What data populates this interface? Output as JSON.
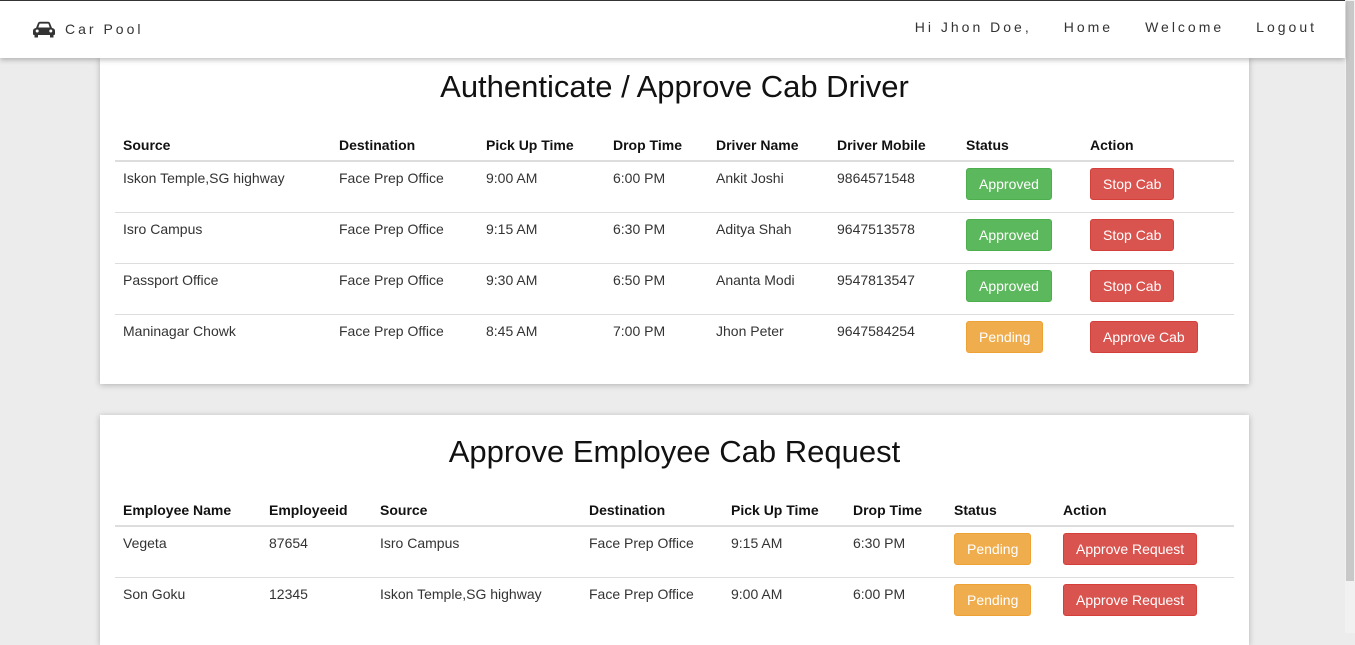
{
  "nav": {
    "brand": "Car Pool",
    "greeting": "Hi Jhon Doe,",
    "links": [
      "Home",
      "Welcome",
      "Logout"
    ]
  },
  "drivers_section": {
    "title": "Authenticate / Approve Cab Driver",
    "headers": [
      "Source",
      "Destination",
      "Pick Up Time",
      "Drop Time",
      "Driver Name",
      "Driver Mobile",
      "Status",
      "Action"
    ],
    "rows": [
      {
        "source": "Iskon Temple,SG highway",
        "destination": "Face Prep Office",
        "pickup": "9:00 AM",
        "drop": "6:00 PM",
        "driver": "Ankit Joshi",
        "mobile": "9864571548",
        "status": "Approved",
        "action": "Stop Cab"
      },
      {
        "source": "Isro Campus",
        "destination": "Face Prep Office",
        "pickup": "9:15 AM",
        "drop": "6:30 PM",
        "driver": "Aditya Shah",
        "mobile": "9647513578",
        "status": "Approved",
        "action": "Stop Cab"
      },
      {
        "source": "Passport Office",
        "destination": "Face Prep Office",
        "pickup": "9:30 AM",
        "drop": "6:50 PM",
        "driver": "Ananta Modi",
        "mobile": "9547813547",
        "status": "Approved",
        "action": "Stop Cab"
      },
      {
        "source": "Maninagar Chowk",
        "destination": "Face Prep Office",
        "pickup": "8:45 AM",
        "drop": "7:00 PM",
        "driver": "Jhon Peter",
        "mobile": "9647584254",
        "status": "Pending",
        "action": "Approve Cab"
      }
    ]
  },
  "employees_section": {
    "title": "Approve Employee Cab Request",
    "headers": [
      "Employee Name",
      "Employeeid",
      "Source",
      "Destination",
      "Pick Up Time",
      "Drop Time",
      "Status",
      "Action"
    ],
    "rows": [
      {
        "name": "Vegeta",
        "id": "87654",
        "source": "Isro Campus",
        "destination": "Face Prep Office",
        "pickup": "9:15 AM",
        "drop": "6:30 PM",
        "status": "Pending",
        "action": "Approve Request"
      },
      {
        "name": "Son Goku",
        "id": "12345",
        "source": "Iskon Temple,SG highway",
        "destination": "Face Prep Office",
        "pickup": "9:00 AM",
        "drop": "6:00 PM",
        "status": "Pending",
        "action": "Approve Request"
      }
    ]
  },
  "colors": {
    "approved": "#5cb85c",
    "pending": "#f0ad4e",
    "danger": "#d9534f"
  }
}
